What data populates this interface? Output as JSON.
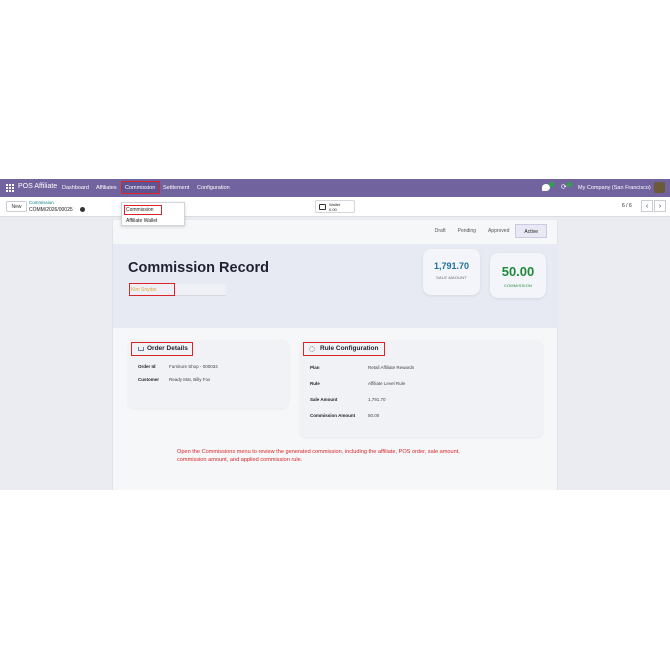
{
  "navbar": {
    "brand": "POS Affiliate",
    "menus": [
      "Dashboard",
      "Affiliates",
      "Commission",
      "Settlement",
      "Configuration"
    ],
    "company": "My Company (San Francisco)"
  },
  "control": {
    "new_label": "New",
    "breadcrumb_parent": "Commission",
    "breadcrumb_current": "COMM/2026/00025",
    "wallet_label": "Wallet",
    "wallet_value": "0.00",
    "pager": "6 / 6"
  },
  "dropdown": {
    "items": [
      "Commission",
      "Affiliate Wallet"
    ]
  },
  "status": {
    "items": [
      "Draft",
      "Pending",
      "Approved",
      "Active"
    ],
    "active": "Active"
  },
  "record": {
    "title": "Commission Record",
    "affiliate": "Kim Snyder",
    "sale_amount_value": "1,791.70",
    "sale_amount_label": "SALE AMOUNT",
    "commission_value": "50.00",
    "commission_label": "COMMISSION"
  },
  "order_details": {
    "title": "Order Details",
    "rows": [
      {
        "label": "Order Id",
        "value": "Furniture Shop - 000034"
      },
      {
        "label": "Customer",
        "value": "Ready Mat, Billy Fox"
      }
    ]
  },
  "rule_config": {
    "title": "Rule Configuration",
    "rows": [
      {
        "label": "Plan",
        "value": "Retail Affiliate Rewards"
      },
      {
        "label": "Rule",
        "value": "Affiliate Level Rule"
      },
      {
        "label": "Sale Amount",
        "value": "1,791.70"
      },
      {
        "label": "Commission Amount",
        "value": "50.00"
      }
    ]
  },
  "hint": "Open the Commissions menu to review the generated commission, including the affiliate, POS order, sale amount, commission amount, and applied commission rule.",
  "colors": {
    "navbar": "#71639e",
    "highlight": "#d9252a",
    "sale_amount": "#1a6f9e",
    "commission": "#1e8a3a"
  }
}
